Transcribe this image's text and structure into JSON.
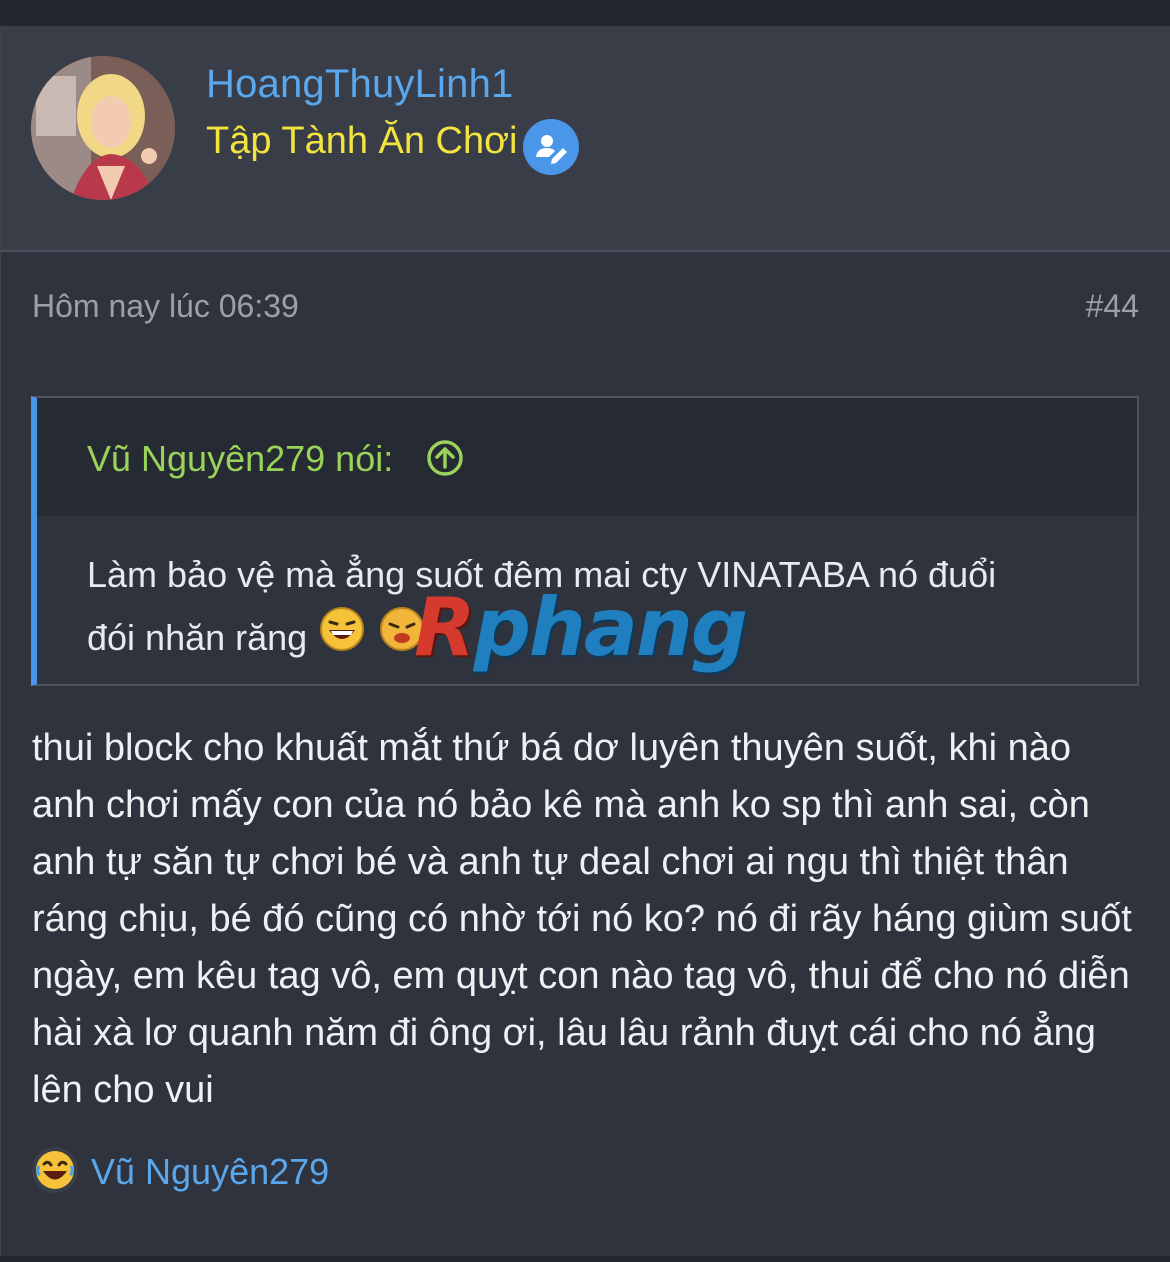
{
  "user": {
    "username": "HoangThuyLinh1",
    "title": "Tập Tành Ăn Chơi",
    "edit_icon": "user-edit-icon"
  },
  "post": {
    "timestamp": "Hôm nay lúc 06:39",
    "number": "#44",
    "quote": {
      "author": "Vũ Nguyên279 nói:",
      "jump_icon": "arrow-up-circle-icon",
      "line1": "Làm bảo vệ mà ẳng suốt đêm mai cty VINATABA nó đuổi",
      "line2": "đói nhăn răng",
      "emojis": [
        "laughing-emoji-icon",
        "angry-emoji-icon"
      ]
    },
    "watermark": {
      "first": "R",
      "rest": "phang"
    },
    "body": "thui block cho khuất mắt thứ bá dơ luyên thuyên suốt, khi nào anh chơi mấy con của nó bảo kê mà anh ko sp thì anh sai, còn anh tự săn tự chơi bé và anh tự deal chơi ai ngu thì thiệt thân ráng chịu, bé đó cũng có nhờ tới nó ko? nó đi rãy háng giùm suốt ngày, em kêu tag vô, em quỵt con nào tag vô, thui để cho nó diễn hài xà lơ quanh năm đi ông ơi, lâu lâu rảnh đuỵt cái cho nó ẳng lên cho vui",
    "reaction": {
      "icon": "laugh-reaction-icon",
      "user": "Vũ Nguyên279"
    }
  },
  "colors": {
    "username": "#5aa7ec",
    "user_title": "#f3e33f",
    "quote_author": "#9ad25a",
    "quote_border": "#4a96e8"
  }
}
